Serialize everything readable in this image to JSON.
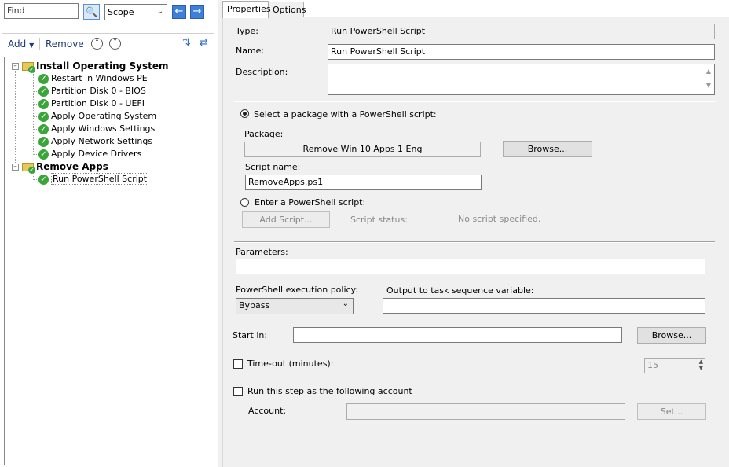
{
  "left": {
    "find_value": "Find",
    "scope_value": "Scope",
    "add_label": "Add",
    "remove_label": "Remove",
    "tree": [
      {
        "label": "Install Operating System",
        "group": true
      },
      {
        "label": "Restart in Windows PE"
      },
      {
        "label": "Partition Disk 0 - BIOS"
      },
      {
        "label": "Partition Disk 0 - UEFI"
      },
      {
        "label": "Apply Operating System"
      },
      {
        "label": "Apply Windows Settings"
      },
      {
        "label": "Apply Network Settings"
      },
      {
        "label": "Apply Device Drivers"
      },
      {
        "label": "Remove Apps",
        "group": true
      },
      {
        "label": "Run PowerShell Script"
      }
    ]
  },
  "tabs": {
    "properties": "Properties",
    "options": "Options"
  },
  "props": {
    "type_label": "Type:",
    "type_value": "Run PowerShell Script",
    "name_label": "Name:",
    "name_value": "Run PowerShell Script",
    "description_label": "Description:",
    "description_value": "",
    "select_package_label": "Select a package with a PowerShell script:",
    "package_label": "Package:",
    "package_value": "Remove Win 10 Apps 1 Eng",
    "browse_label": "Browse...",
    "script_name_label": "Script name:",
    "script_name_value": "RemoveApps.ps1",
    "enter_script_label": "Enter a PowerShell script:",
    "add_script_label": "Add Script...",
    "script_status_label": "Script status:",
    "script_status_value": "No script specified.",
    "parameters_label": "Parameters:",
    "parameters_value": "",
    "policy_label": "PowerShell execution policy:",
    "policy_value": "Bypass",
    "output_var_label": "Output to task sequence variable:",
    "output_var_value": "",
    "start_in_label": "Start in:",
    "start_in_value": "",
    "start_in_browse": "Browse...",
    "timeout_label": "Time-out (minutes):",
    "timeout_value": "15",
    "run_as_label": "Run this step as the following account",
    "account_label": "Account:",
    "account_value": "",
    "set_label": "Set..."
  }
}
